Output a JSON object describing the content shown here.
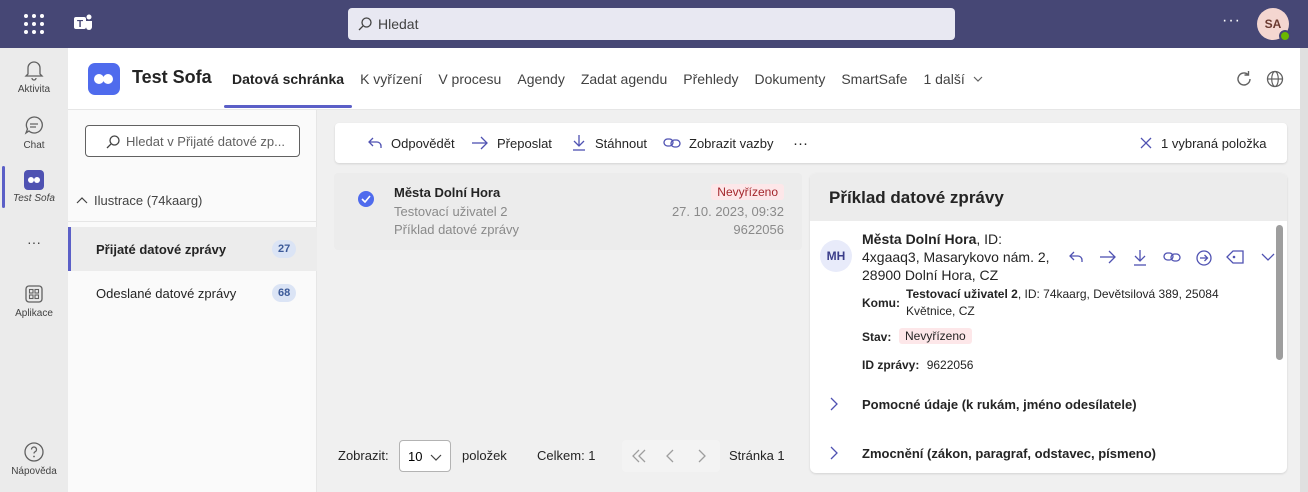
{
  "topbar": {
    "search_placeholder": "Hledat",
    "more": "···",
    "avatar_initials": "SA"
  },
  "rail": {
    "items": [
      {
        "label": "Aktivita",
        "icon": "bell-icon"
      },
      {
        "label": "Chat",
        "icon": "chat-icon"
      },
      {
        "label": "Test Sofa",
        "icon": "test-sofa-icon"
      },
      {
        "label": "···",
        "icon": "more-icon"
      },
      {
        "label": "Aplikace",
        "icon": "apps-icon"
      },
      {
        "label": "Nápověda",
        "icon": "help-icon"
      }
    ]
  },
  "app": {
    "title": "Test Sofa",
    "tabs": [
      {
        "label": "Datová schránka",
        "active": true
      },
      {
        "label": "K vyřízení"
      },
      {
        "label": "V procesu"
      },
      {
        "label": "Agendy"
      },
      {
        "label": "Zadat agendu"
      },
      {
        "label": "Přehledy"
      },
      {
        "label": "Dokumenty"
      },
      {
        "label": "SmartSafe"
      },
      {
        "label": "1 další"
      }
    ]
  },
  "folders": {
    "search_placeholder": "Hledat v Přijaté datové zp...",
    "root": "Ilustrace (74kaarg)",
    "items": [
      {
        "label": "Přijaté datové zprávy",
        "count": "27",
        "active": true
      },
      {
        "label": "Odeslané datové zprávy",
        "count": "68"
      }
    ]
  },
  "toolbar": {
    "reply": "Odpovědět",
    "forward": "Přeposlat",
    "download": "Stáhnout",
    "links": "Zobrazit vazby",
    "more": "···",
    "selected": "1 vybraná položka"
  },
  "messages": [
    {
      "sender": "Města Dolní Hora",
      "recipient": "Testovací uživatel 2",
      "subject": "Příklad datové zprávy",
      "status": "Nevyřízeno",
      "date": "27. 10. 2023, 09:32",
      "id": "9622056"
    }
  ],
  "pager": {
    "show_label": "Zobrazit:",
    "page_size": "10",
    "items_label": "položek",
    "total": "Celkem: 1",
    "page": "Stránka 1"
  },
  "detail": {
    "title": "Příklad datové zprávy",
    "avatar": "MH",
    "from_name": "Města Dolní Hora",
    "from_rest": ", ID: 4xgaaq3, Masarykovo nám. 2, 28900 Dolní Hora, CZ",
    "to_label": "Komu:",
    "to_name": "Testovací uživatel 2",
    "to_rest": ", ID: 74kaarg, Devětsilová 389, 25084 Květnice, CZ",
    "status_label": "Stav:",
    "status": "Nevyřízeno",
    "id_label": "ID zprávy:",
    "id": "9622056",
    "sections": [
      "Pomocné údaje (k rukám, jméno odesílatele)",
      "Zmocnění (zákon, paragraf, odstavec, písmeno)"
    ]
  },
  "colors": {
    "topbar": "#464775",
    "accent": "#5b5fc7",
    "badge_bg": "#fde7e9",
    "badge_fg": "#a4262c"
  }
}
